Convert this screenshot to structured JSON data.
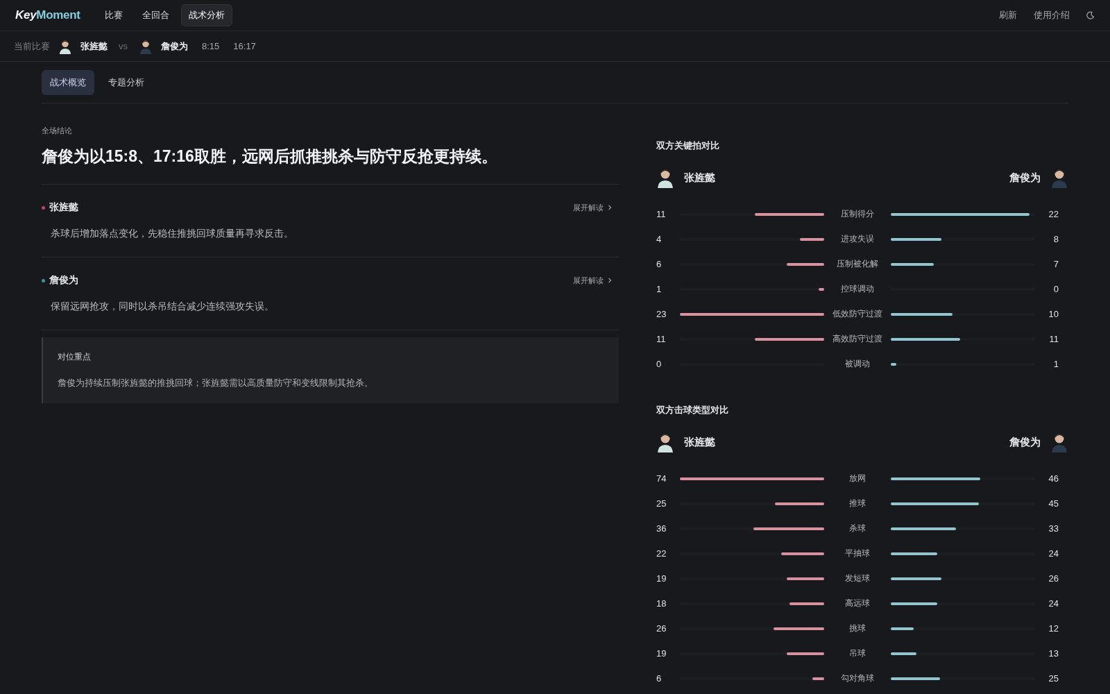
{
  "header": {
    "logo": [
      {
        "text": "Key",
        "kind": "plain"
      },
      {
        "text": "Moment",
        "kind": "accent"
      }
    ],
    "nav": [
      {
        "label": "比赛",
        "selected": false
      },
      {
        "label": "全回合",
        "selected": false
      },
      {
        "label": "战术分析",
        "selected": true
      }
    ],
    "actions": [
      "刷新",
      "使用介绍"
    ]
  },
  "match_bar": {
    "label": "当前比赛",
    "player_a": "张旌懿",
    "vs": "vs",
    "player_b": "詹俊为",
    "scores": [
      "8:15",
      "16:17"
    ]
  },
  "subtabs": [
    {
      "label": "战术概览",
      "selected": true
    },
    {
      "label": "专题分析",
      "selected": false
    }
  ],
  "conclusion": {
    "label": "全场结论",
    "headline": "詹俊为以15:8、17:16取胜，远网后抓推挑杀与防守反抢更持续。"
  },
  "insights": [
    {
      "player": "张旌懿",
      "color": "#c4425c",
      "action": "展开解读",
      "text": "杀球后增加落点变化，先稳住推挑回球质量再寻求反击。"
    },
    {
      "player": "詹俊为",
      "color": "#3f8f9c",
      "action": "展开解读",
      "text": "保留远网抢攻，同时以杀吊结合减少连续强攻失误。"
    }
  ],
  "focus": {
    "title": "对位重点",
    "text": "詹俊为持续压制张旌懿的推挑回球；张旌懿需以高质量防守和变线限制其抢杀。"
  },
  "comparisons": [
    {
      "title": "双方关键拍对比",
      "player_a": "张旌懿",
      "player_b": "詹俊为",
      "rows": [
        {
          "label": "压制得分",
          "left": {
            "value": "11",
            "level": 0.48
          },
          "right": {
            "value": "22",
            "level": 0.96
          }
        },
        {
          "label": "进攻失误",
          "left": {
            "value": "4",
            "level": 0.17
          },
          "right": {
            "value": "8",
            "level": 0.35
          }
        },
        {
          "label": "压制被化解",
          "left": {
            "value": "6",
            "level": 0.26
          },
          "right": {
            "value": "7",
            "level": 0.3
          }
        },
        {
          "label": "控球调动",
          "left": {
            "value": "1",
            "level": 0.04
          },
          "right": {
            "value": "0",
            "level": 0
          }
        },
        {
          "label": "低效防守过渡",
          "left": {
            "value": "23",
            "level": 1
          },
          "right": {
            "value": "10",
            "level": 0.43
          }
        },
        {
          "label": "高效防守过渡",
          "left": {
            "value": "11",
            "level": 0.48
          },
          "right": {
            "value": "11",
            "level": 0.48
          }
        },
        {
          "label": "被调动",
          "left": {
            "value": "0",
            "level": 0
          },
          "right": {
            "value": "1",
            "level": 0.04
          }
        }
      ]
    },
    {
      "title": "双方击球类型对比",
      "player_a": "张旌懿",
      "player_b": "詹俊为",
      "rows": [
        {
          "label": "放网",
          "left": {
            "value": "74",
            "level": 1
          },
          "right": {
            "value": "46",
            "level": 0.62
          }
        },
        {
          "label": "推球",
          "left": {
            "value": "25",
            "level": 0.34
          },
          "right": {
            "value": "45",
            "level": 0.61
          }
        },
        {
          "label": "杀球",
          "left": {
            "value": "36",
            "level": 0.49
          },
          "right": {
            "value": "33",
            "level": 0.45
          }
        },
        {
          "label": "平抽球",
          "left": {
            "value": "22",
            "level": 0.3
          },
          "right": {
            "value": "24",
            "level": 0.32
          }
        },
        {
          "label": "发短球",
          "left": {
            "value": "19",
            "level": 0.26
          },
          "right": {
            "value": "26",
            "level": 0.35
          }
        },
        {
          "label": "高远球",
          "left": {
            "value": "18",
            "level": 0.24
          },
          "right": {
            "value": "24",
            "level": 0.32
          }
        },
        {
          "label": "挑球",
          "left": {
            "value": "26",
            "level": 0.35
          },
          "right": {
            "value": "12",
            "level": 0.16
          }
        },
        {
          "label": "吊球",
          "left": {
            "value": "19",
            "level": 0.26
          },
          "right": {
            "value": "13",
            "level": 0.18
          }
        },
        {
          "label": "勾对角球",
          "left": {
            "value": "6",
            "level": 0.08
          },
          "right": {
            "value": "25",
            "level": 0.34
          }
        }
      ]
    }
  ]
}
